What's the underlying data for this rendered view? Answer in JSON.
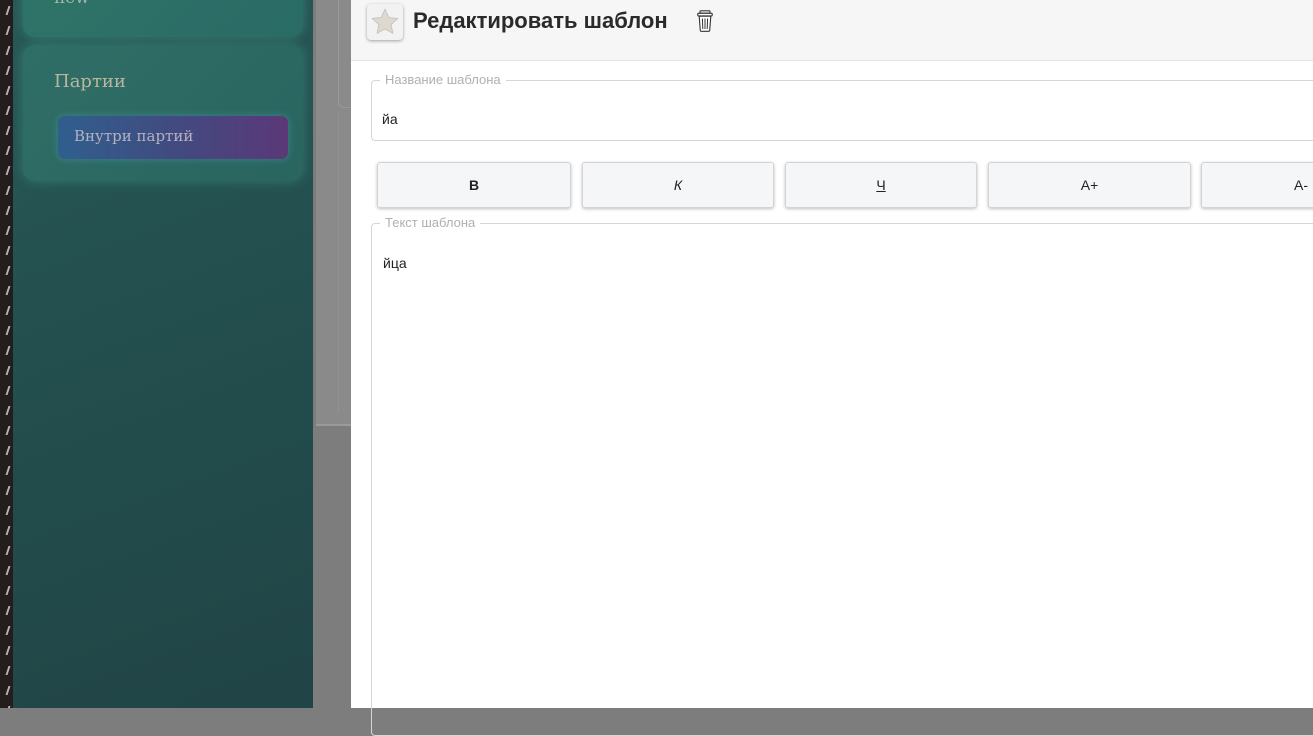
{
  "sidebar": {
    "top_card_label": "new",
    "section_title": "Партии",
    "inside_parties_button": "Внутри партий"
  },
  "modal": {
    "title": "Редактировать шаблон",
    "star_icon": "star-icon",
    "trash_icon": "trash-icon",
    "name_field": {
      "legend": "Название шаблона",
      "value": "йа"
    },
    "toolbar": {
      "bold": "B",
      "italic": "К",
      "underline": "Ч",
      "increase_font": "A+",
      "decrease_font": "A-"
    },
    "text_field": {
      "legend": "Текст шаблона",
      "value": "йца"
    }
  },
  "colors": {
    "sidebar_bg": "#234f4e",
    "card_bg": "#2f6e66",
    "button_gradient_start": "#2f5f8d",
    "button_gradient_end": "#5b3878",
    "overlay": "#7d7d7d"
  }
}
